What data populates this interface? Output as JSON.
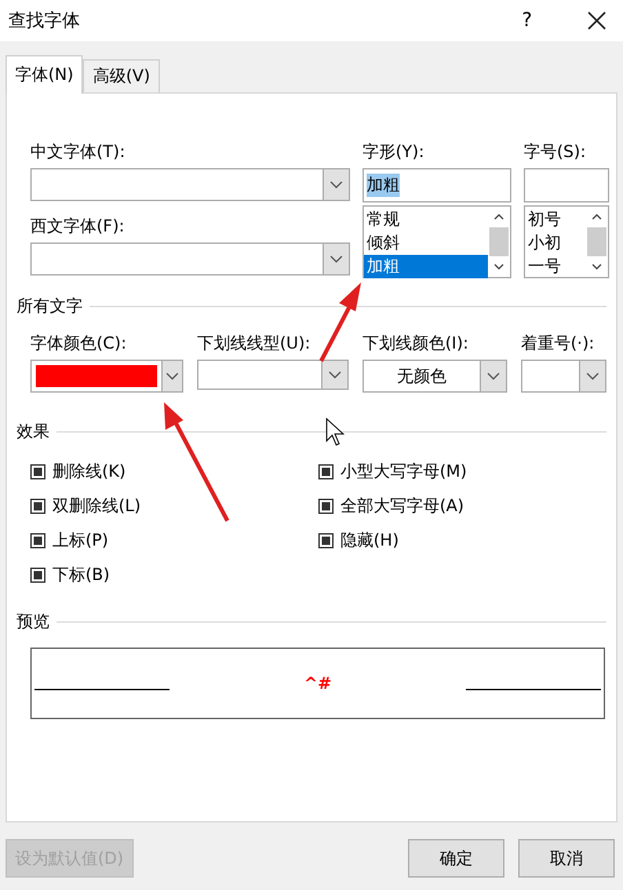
{
  "window": {
    "title": "查找字体",
    "help": "?"
  },
  "tabs": [
    {
      "label": "字体(N)",
      "selected": true
    },
    {
      "label": "高级(V)",
      "selected": false
    }
  ],
  "font": {
    "chinese_label": "中文字体(T):",
    "western_label": "西文字体(F):",
    "style": {
      "label": "字形(Y):",
      "value": "加粗",
      "options": [
        {
          "label": "常规",
          "selected": false
        },
        {
          "label": "倾斜",
          "selected": false
        },
        {
          "label": "加粗",
          "selected": true
        }
      ]
    },
    "size": {
      "label": "字号(S):",
      "options": [
        {
          "label": "初号",
          "selected": false
        },
        {
          "label": "小初",
          "selected": false
        },
        {
          "label": "一号",
          "selected": false
        }
      ]
    }
  },
  "all_text": {
    "heading": "所有文字",
    "font_color": {
      "label": "字体颜色(C):",
      "color": "#ff0000"
    },
    "underline_style": {
      "label": "下划线线型(U):"
    },
    "underline_color": {
      "label": "下划线颜色(I):",
      "value": "无颜色"
    },
    "emphasis_mark": {
      "label": "着重号(·):"
    }
  },
  "effects": {
    "heading": "效果",
    "left": [
      {
        "label": "删除线(K)",
        "indeterminate": true
      },
      {
        "label": "双删除线(L)",
        "indeterminate": true
      },
      {
        "label": "上标(P)",
        "indeterminate": true
      },
      {
        "label": "下标(B)",
        "indeterminate": true
      }
    ],
    "right": [
      {
        "label": "小型大写字母(M)",
        "indeterminate": true
      },
      {
        "label": "全部大写字母(A)",
        "indeterminate": true
      },
      {
        "label": "隐藏(H)",
        "indeterminate": true
      }
    ]
  },
  "preview": {
    "heading": "预览",
    "sample": "^#"
  },
  "buttons": {
    "default": {
      "label": "设为默认值(D)",
      "disabled": true
    },
    "ok": {
      "label": "确定",
      "disabled": false
    },
    "cancel": {
      "label": "取消",
      "disabled": false
    }
  }
}
